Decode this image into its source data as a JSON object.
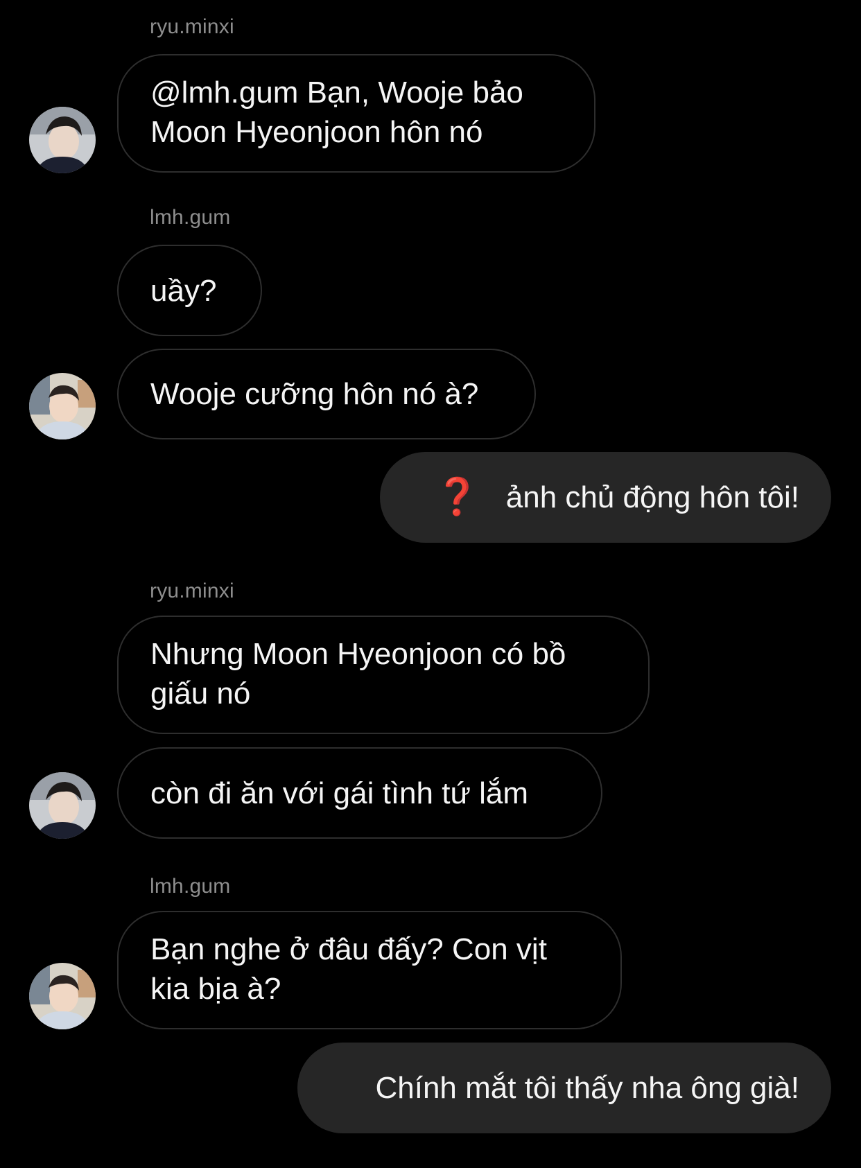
{
  "messages": [
    {
      "sender": "ryu.minxi",
      "text": "@lmh.gum Bạn, Wooje bảo\nMoon Hyeonjoon hôn nó"
    },
    {
      "sender": "lmh.gum",
      "text": "uầy?"
    },
    {
      "text": "Wooje cưỡng hôn nó à?"
    },
    {
      "text": "ảnh chủ động hôn tôi!",
      "icon": "red-question-mark-icon"
    },
    {
      "sender": "ryu.minxi",
      "text": "Nhưng Moon Hyeonjoon có bồ\ngiấu nó"
    },
    {
      "text": "còn đi ăn với gái tình tứ lắm"
    },
    {
      "sender": "lmh.gum",
      "text": "Bạn nghe ở đâu đấy? Con vịt\nkia bịa à?"
    },
    {
      "text": "Chính mắt tôi thấy nha ông già!"
    }
  ],
  "colors": {
    "background": "#000000",
    "sender_name": "#8e8e8e",
    "incoming_border": "#2e2e2e",
    "outgoing_bubble": "#262626",
    "question_icon": "#e0201e"
  }
}
